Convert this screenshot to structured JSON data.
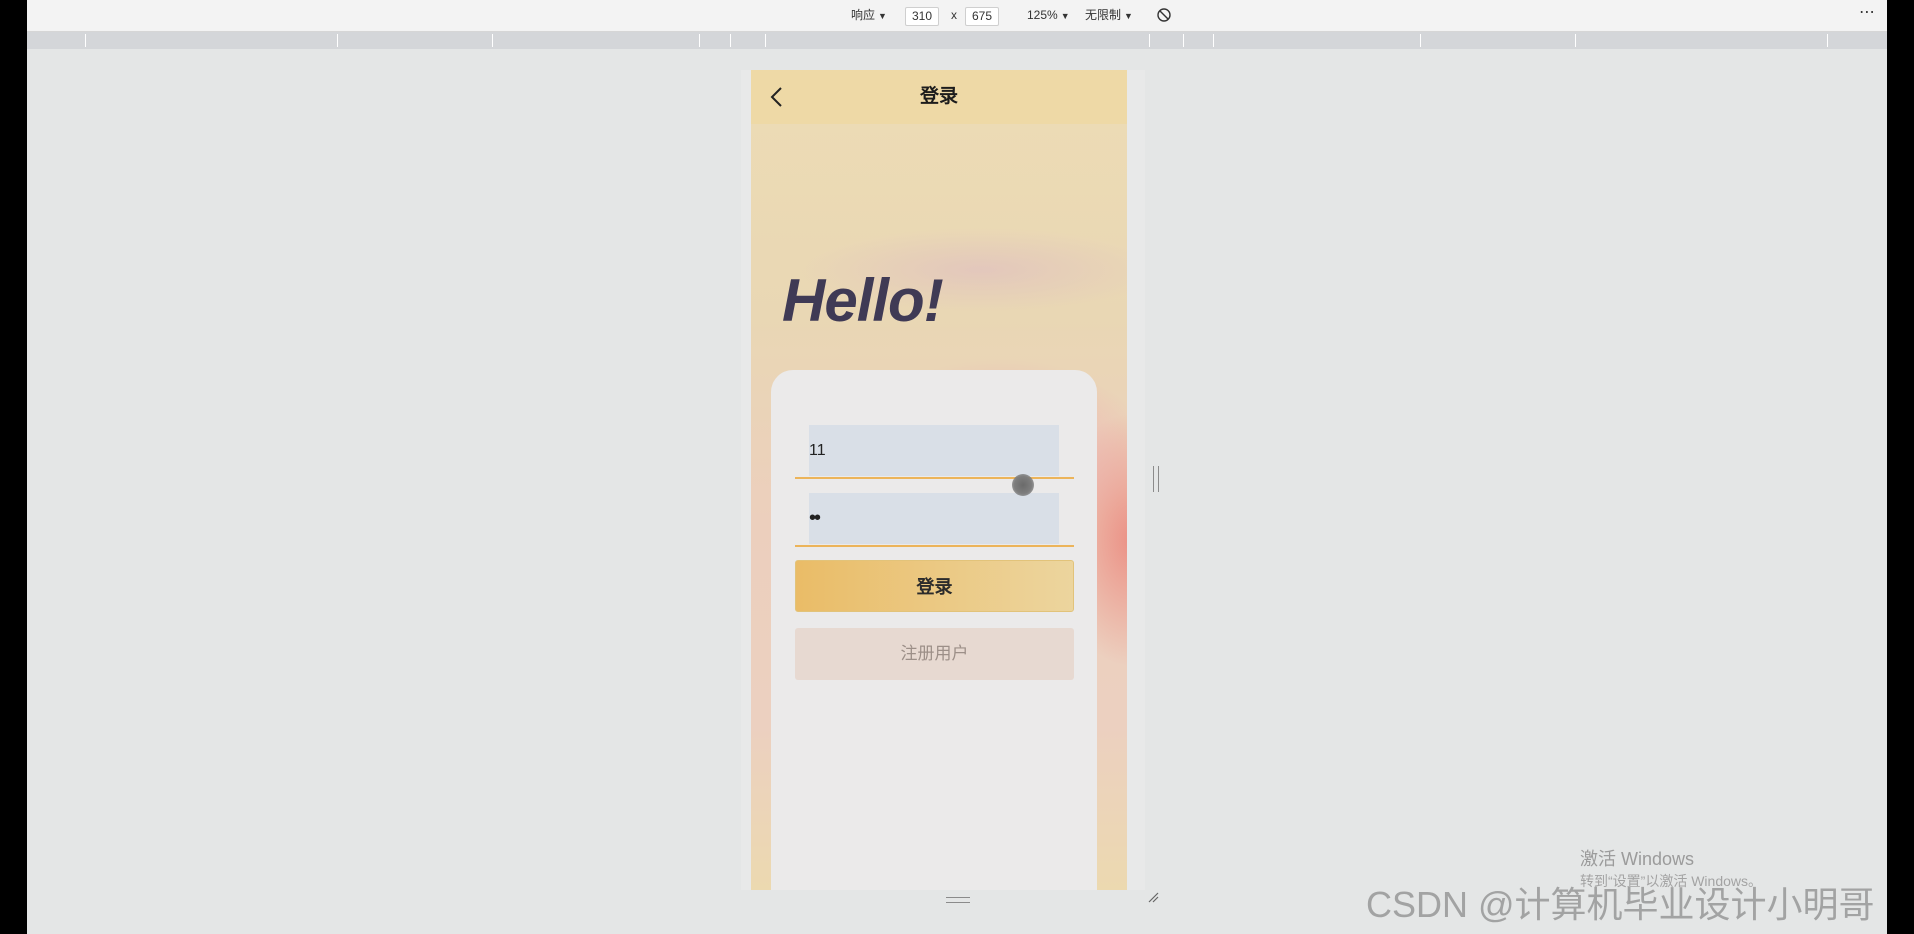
{
  "toolbar": {
    "dimensions_label": "响应",
    "width_value": "310",
    "times_sign": "x",
    "height_value": "675",
    "zoom_label": "125%",
    "throttle_label": "无限制",
    "more_label": "⋯",
    "rotate_icon": "rotate-icon"
  },
  "app": {
    "nav_title": "登录",
    "back_icon": "chevron-left-icon",
    "hello_text": "Hello!",
    "username_value": "11",
    "password_value": "••",
    "login_button": "登录",
    "register_button": "注册用户"
  },
  "overlay": {
    "activate_title": "激活 Windows",
    "activate_sub": "转到“设置”以激活 Windows。",
    "watermark": "CSDN @计算机毕业设计小明哥"
  },
  "colors": {
    "accent": "#ecb45a",
    "nav_bg": "#eed9a6",
    "hello": "#3f3a55",
    "field_bg": "#d9dfe7"
  }
}
